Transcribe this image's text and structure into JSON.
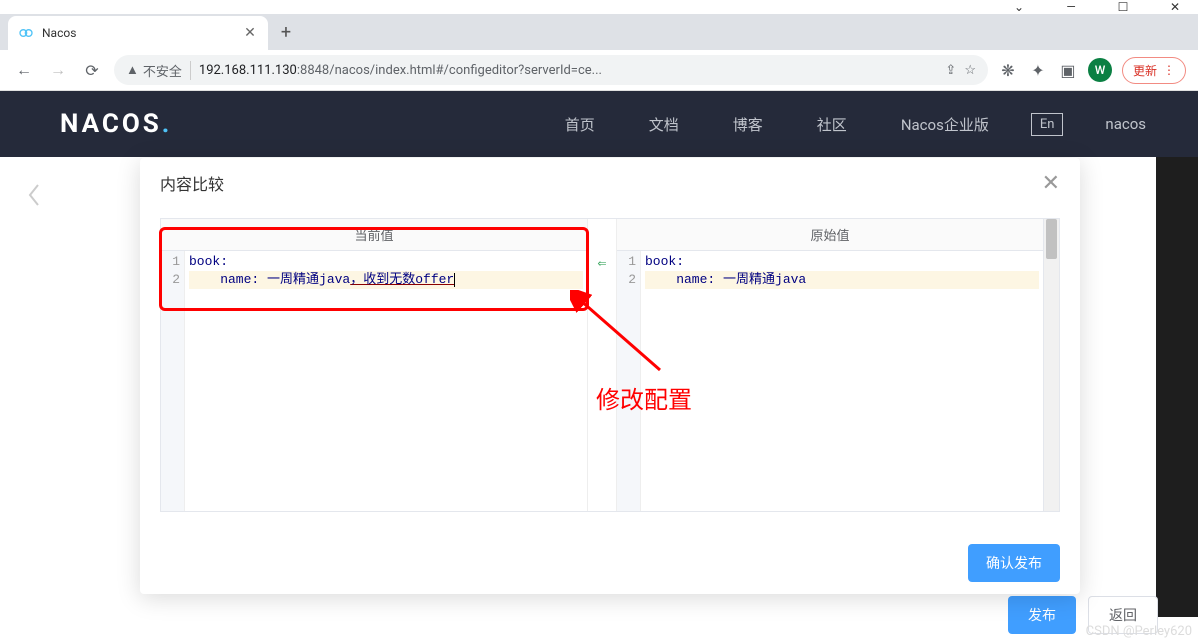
{
  "browser": {
    "tab_title": "Nacos",
    "new_tab_label": "+",
    "url_insecure": "不安全",
    "url_host": "192.168.111.130",
    "url_port": ":8848",
    "url_path": "/nacos/index.html#/configeditor?serverId=ce...",
    "avatar_letter": "W",
    "update_label": "更新"
  },
  "nacos": {
    "logo_text": "NACOS",
    "nav": {
      "home": "首页",
      "docs": "文档",
      "blog": "博客",
      "community": "社区",
      "enterprise": "Nacos企业版",
      "lang": "En",
      "user": "nacos"
    }
  },
  "modal": {
    "title": "内容比较",
    "col_current": "当前值",
    "col_original": "原始值",
    "confirm_btn": "确认发布"
  },
  "code_current": {
    "line1": "book:",
    "line2_prefix": "    name: 一周精通java",
    "line2_diff": "，收到无数offer"
  },
  "code_original": {
    "line1": "book:",
    "line2": "    name: 一周精通java"
  },
  "gutters": {
    "n1": "1",
    "n2": "2",
    "diff_marker": "⇐"
  },
  "bottom_actions": {
    "publish": "发布",
    "back": "返回"
  },
  "annotation": {
    "text": "修改配置"
  },
  "watermark": "CSDN @Perley620"
}
